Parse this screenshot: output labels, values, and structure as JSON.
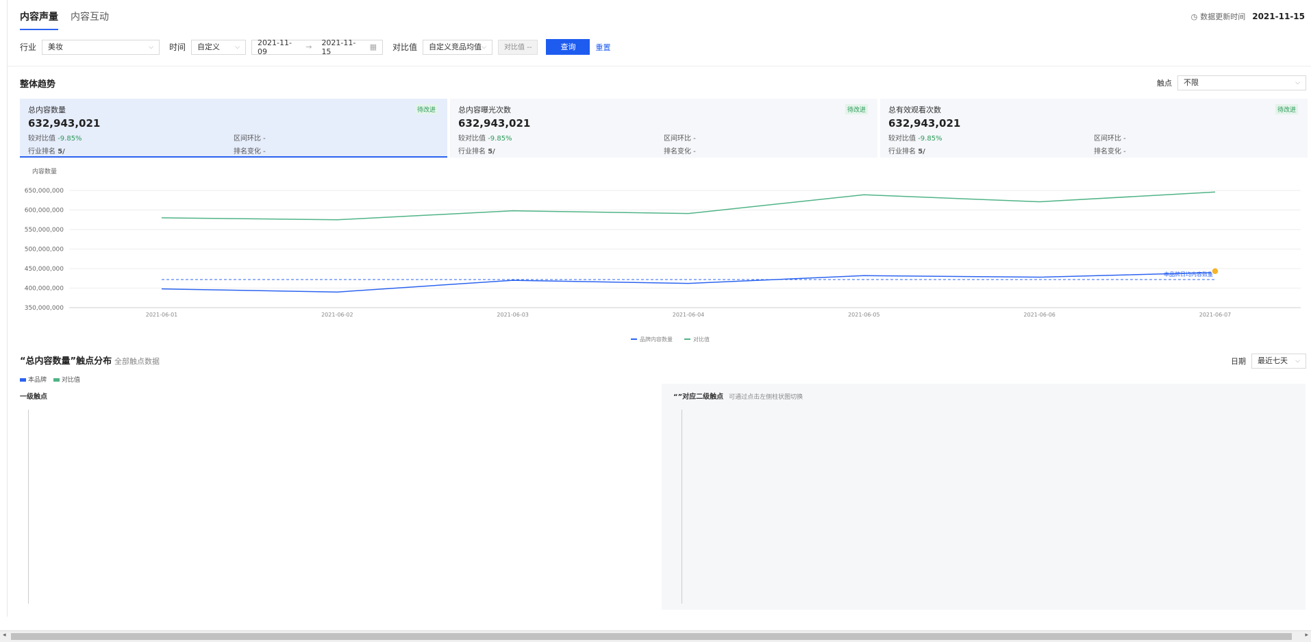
{
  "tabs": [
    "内容声量",
    "内容互动"
  ],
  "update": {
    "label": "数据更新时间",
    "date": "2021-11-15"
  },
  "filters": {
    "industry_label": "行业",
    "industry_value": "美妆",
    "time_label": "时间",
    "time_value": "自定义",
    "date_start": "2021-11-09",
    "date_sep": "→",
    "date_end": "2021-11-15",
    "compare_label": "对比值",
    "compare_value": "自定义竞品均值",
    "compare_box": "对比值  --",
    "query": "查询",
    "reset": "重置"
  },
  "section1": {
    "title": "整体趋势",
    "touch_label": "触点",
    "touch_value": "不限"
  },
  "cards": [
    {
      "title": "总内容数量",
      "value": "632,943,021",
      "badge": "待改进",
      "cmp_label": "较对比值",
      "cmp_value": "-9.85%",
      "period_label": "区间环比 -",
      "rank_label": "行业排名",
      "rank_value": "5/",
      "rank_change": "排名变化 -"
    },
    {
      "title": "总内容曝光次数",
      "value": "632,943,021",
      "badge": "待改进",
      "cmp_label": "较对比值",
      "cmp_value": "-9.85%",
      "period_label": "区间环比 -",
      "rank_label": "行业排名",
      "rank_value": "5/",
      "rank_change": "排名变化 -"
    },
    {
      "title": "总有效观看次数",
      "value": "632,943,021",
      "badge": "待改进",
      "cmp_label": "较对比值",
      "cmp_value": "-9.85%",
      "period_label": "区间环比 -",
      "rank_label": "行业排名",
      "rank_value": "5/",
      "rank_change": "排名变化 -"
    }
  ],
  "chart_data": {
    "type": "line",
    "ylabel": "内容数量",
    "categories": [
      "2021-06-01",
      "2021-06-02",
      "2021-06-03",
      "2021-06-04",
      "2021-06-05",
      "2021-06-06",
      "2021-06-07"
    ],
    "yticks": [
      "650,000,000",
      "600,000,000",
      "550,000,000",
      "500,000,000",
      "450,000,000",
      "400,000,000",
      "350,000,000"
    ],
    "ylim": [
      350000000,
      650000000
    ],
    "series": [
      {
        "name": "品牌内容数量",
        "color": "#2b63f0",
        "values": [
          398000000,
          390000000,
          420000000,
          412000000,
          432000000,
          428000000,
          440000000
        ]
      },
      {
        "name": "对比值",
        "color": "#4fb386",
        "values": [
          580000000,
          575000000,
          598000000,
          591000000,
          639000000,
          621000000,
          646000000
        ]
      }
    ],
    "avg_line": {
      "value": 422000000,
      "label": "本品牌日均内容数量"
    },
    "grid": true,
    "legend": "bottom-center"
  },
  "section2": {
    "title": "“总内容数量”触点分布",
    "subtitle": "全部触点数据",
    "legend": [
      "本品牌",
      "对比值"
    ],
    "date_label": "日期",
    "date_value": "最近七天",
    "level1": "一级触点",
    "level2_title": "“”对应二级触点",
    "level2_hint": "可通过点击左侧柱状图切换"
  }
}
